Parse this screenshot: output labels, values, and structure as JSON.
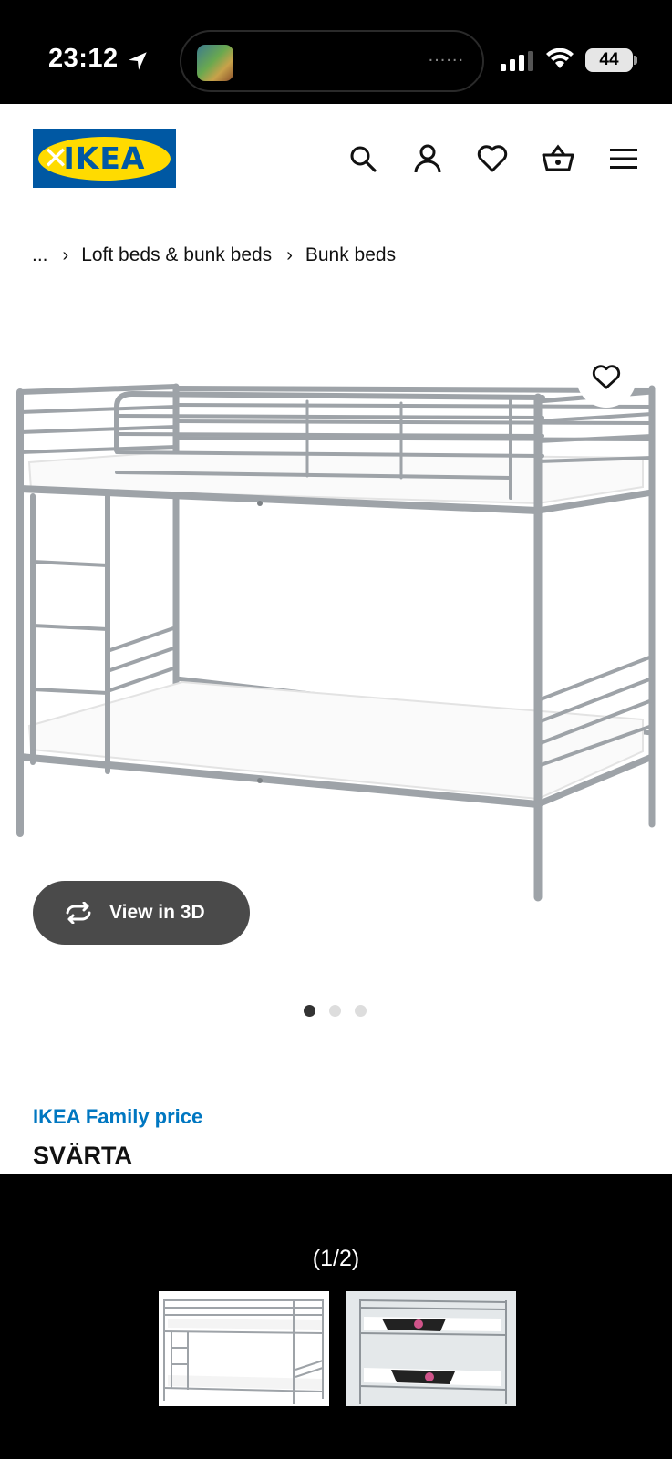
{
  "status_bar": {
    "time": "23:12",
    "battery": "44"
  },
  "island": {
    "dots": "......"
  },
  "header": {
    "logo_text": "IKEA",
    "icons": [
      "search-icon",
      "profile-icon",
      "heart-icon",
      "basket-icon",
      "menu-icon"
    ]
  },
  "breadcrumb": {
    "ellipsis": "...",
    "items": [
      "Loft beds & bunk beds",
      "Bunk beds"
    ]
  },
  "product": {
    "view_3d_label": "View in 3D",
    "carousel": {
      "count": 3,
      "active": 0
    },
    "family_price_label": "IKEA Family price",
    "name": "SVÄRTA"
  },
  "viewer": {
    "counter": "(1/2)"
  },
  "colors": {
    "ikea_blue": "#0058a3",
    "ikea_yellow": "#ffdb00",
    "family_blue": "#0077c1"
  }
}
